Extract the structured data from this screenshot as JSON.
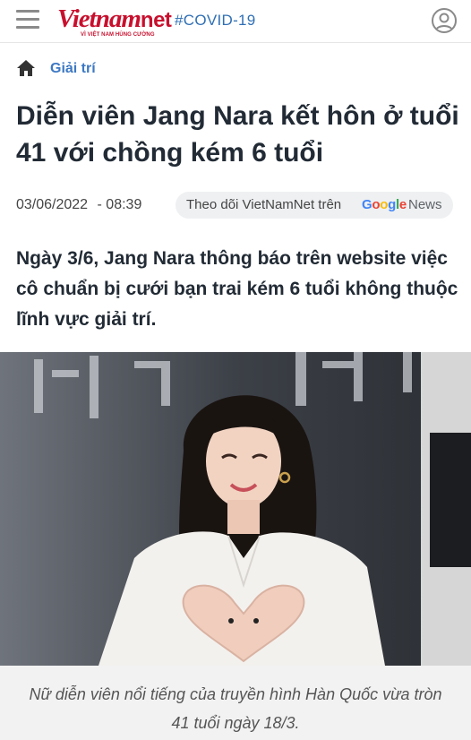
{
  "header": {
    "menu_icon": "hamburger-menu-icon",
    "logo_text": "Vietnamnet",
    "logo_tagline": "VÌ VIỆT NAM HÙNG CƯỜNG",
    "hashtag": "#COVID-19",
    "user_icon": "user-account-icon"
  },
  "breadcrumb": {
    "home_icon": "home-icon",
    "category": "Giải trí"
  },
  "article": {
    "title": "Diễn viên Jang Nara kết hôn ở tuổi 41 với chồng kém 6 tuổi",
    "date": "03/06/2022",
    "time": "- 08:39",
    "follow_text": "Theo dõi VietNamNet trên",
    "google_news": "News",
    "sapo": "Ngày 3/6, Jang Nara thông báo trên website việc cô chuẩn bị cưới bạn trai kém 6 tuổi không thuộc lĩnh vực giải trí.",
    "image_caption": "Nữ diễn viên nổi tiếng của truyền hình Hàn Quốc vừa tròn 41 tuổi ngày 18/3."
  },
  "colors": {
    "brand_red": "#c8102e",
    "link_blue": "#3c78c3",
    "hashtag_blue": "#2f6fb4"
  }
}
